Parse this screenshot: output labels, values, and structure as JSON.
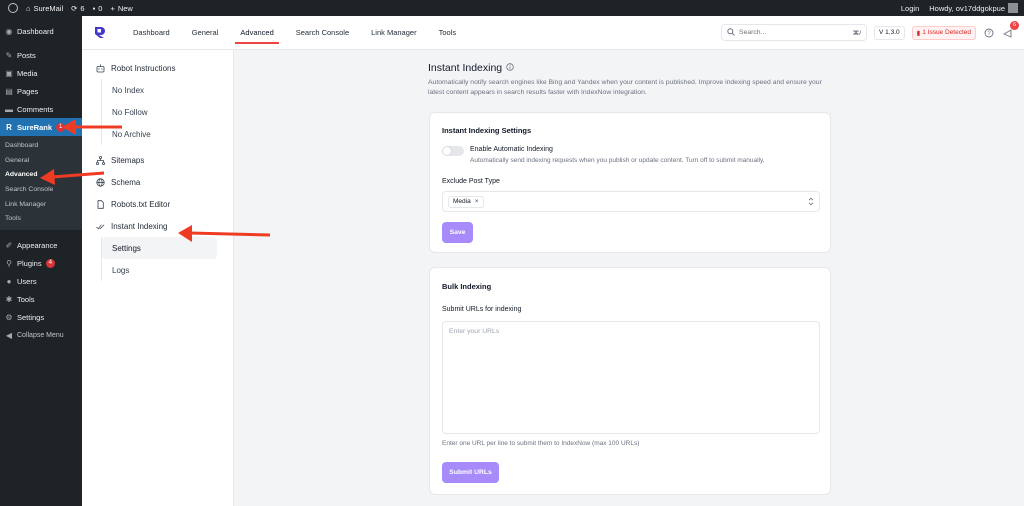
{
  "adminbar": {
    "site_name": "SureMail",
    "updates_count": "6",
    "comments_count": "0",
    "new_label": "New",
    "login_label": "Login",
    "howdy_label": "Howdy, ov17ddgokpue"
  },
  "wp_menu": {
    "dashboard": "Dashboard",
    "posts": "Posts",
    "media": "Media",
    "pages": "Pages",
    "comments": "Comments",
    "surerank": "SureRank",
    "surerank_badge": "1",
    "submenu": [
      "Dashboard",
      "General",
      "Advanced",
      "Search Console",
      "Link Manager",
      "Tools"
    ],
    "appearance": "Appearance",
    "plugins": "Plugins",
    "plugins_badge": "4",
    "users": "Users",
    "tools": "Tools",
    "settings": "Settings",
    "collapse": "Collapse Menu"
  },
  "topnav": {
    "tabs": [
      "Dashboard",
      "General",
      "Advanced",
      "Search Console",
      "Link Manager",
      "Tools"
    ],
    "active_tab": "Advanced",
    "search_placeholder": "Search...",
    "search_shortcut": "⌘/",
    "version": "V 1.3.0",
    "issue_label": "1 Issue Detected",
    "notification_count": "6"
  },
  "inner_sidebar": {
    "robot_instructions": "Robot Instructions",
    "robot_children": [
      "No Index",
      "No Follow",
      "No Archive"
    ],
    "sitemaps": "Sitemaps",
    "schema": "Schema",
    "robots_txt": "Robots.txt Editor",
    "instant_indexing": "Instant Indexing",
    "indexing_children": [
      "Settings",
      "Logs"
    ]
  },
  "main": {
    "title": "Instant Indexing",
    "description": "Automatically notify search engines like Bing and Yandex when your content is published. Improve indexing speed and ensure your latest content appears in search results faster with IndexNow integration.",
    "settings_card": {
      "title": "Instant Indexing Settings",
      "toggle_label": "Enable Automatic Indexing",
      "toggle_help": "Automatically send indexing requests when you publish or update content. Turn off to submit manually.",
      "toggle_on": false,
      "exclude_label": "Exclude Post Type",
      "exclude_chip": "Media",
      "save_label": "Save"
    },
    "bulk_card": {
      "title": "Bulk Indexing",
      "urls_label": "Submit URLs for indexing",
      "urls_placeholder": "Enter your URLs",
      "urls_help": "Enter one URL per line to submit them to IndexNow (max 100 URLs)",
      "submit_label": "Submit URLs"
    }
  },
  "colors": {
    "accent": "#a78bfa",
    "wp_active": "#2271b1",
    "annotation_arrow": "#ef3b24"
  }
}
